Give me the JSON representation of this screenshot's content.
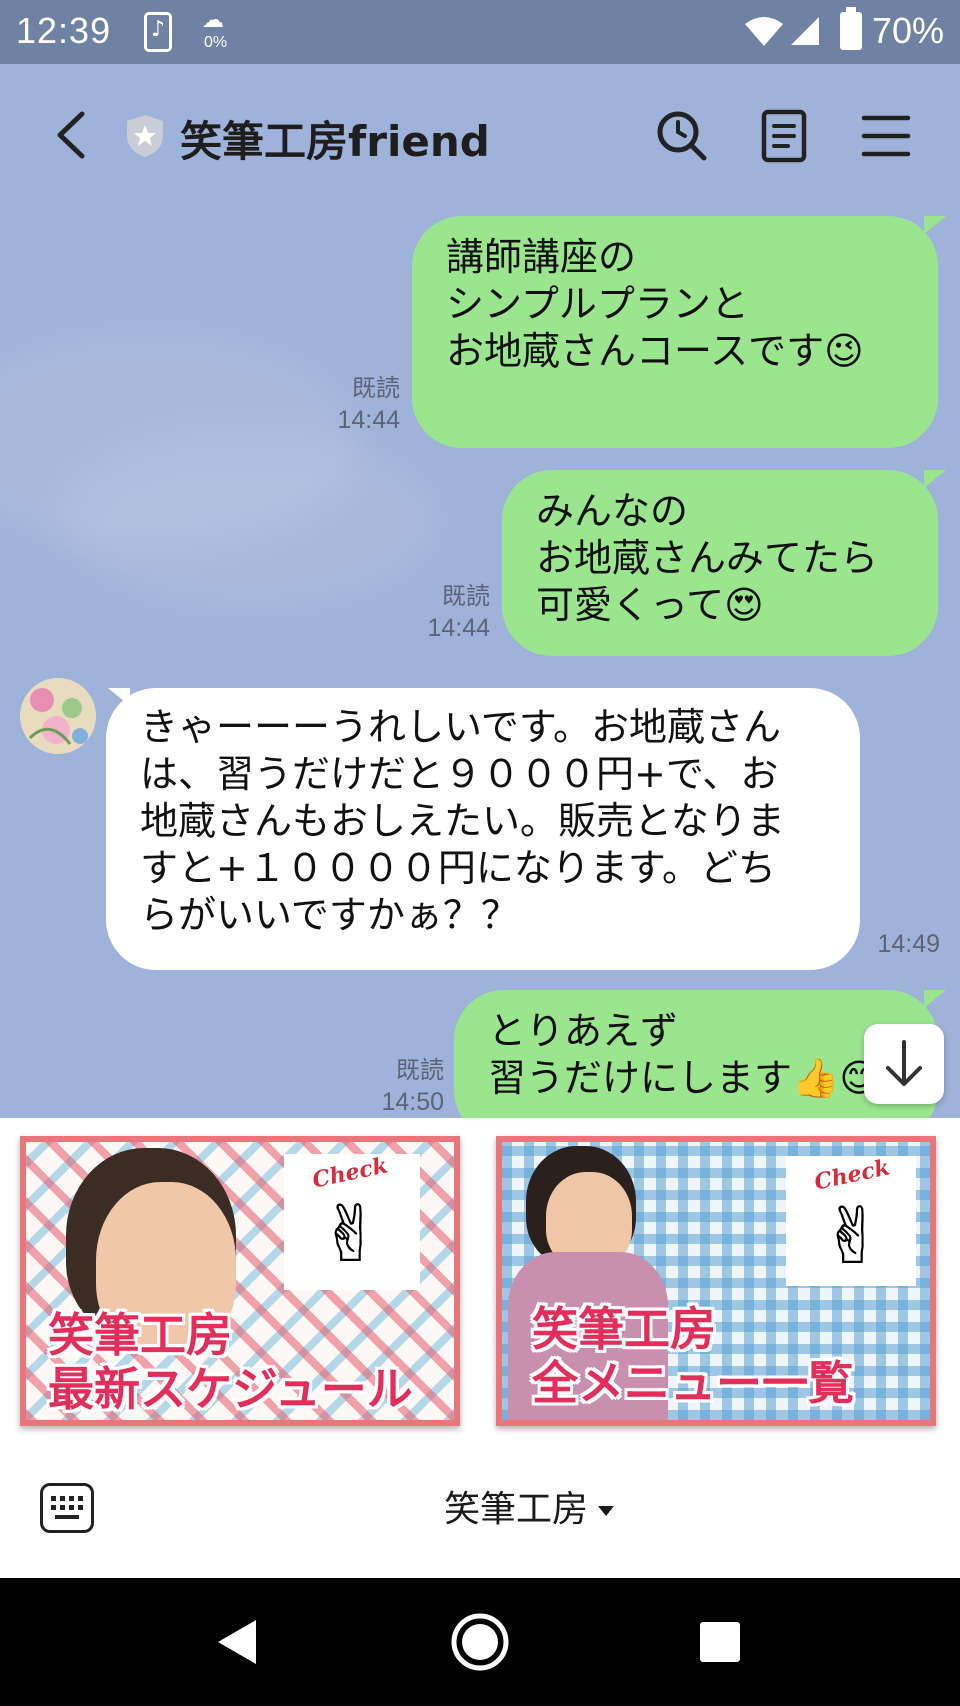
{
  "status_bar": {
    "time": "12:39",
    "weather_percent": "0%",
    "battery": "70%",
    "icons": [
      "music-notification-icon",
      "weather-icon",
      "wifi-icon",
      "signal-icon",
      "battery-icon"
    ]
  },
  "header": {
    "title": "笑筆工房friend",
    "icons": [
      "back-icon",
      "official-account-shield-icon",
      "search-icon",
      "notes-icon",
      "menu-icon"
    ]
  },
  "messages": [
    {
      "direction": "out",
      "lines": [
        "講師講座の",
        "シンプルプランと",
        "お地蔵さんコースです😉"
      ],
      "read": "既読",
      "time": "14:44"
    },
    {
      "direction": "out",
      "lines": [
        "みんなの",
        "お地蔵さんみてたら",
        "可愛くって😍"
      ],
      "read": "既読",
      "time": "14:44"
    },
    {
      "direction": "in",
      "lines": [
        "きゃーーーうれしいです。お地蔵さん",
        "は、習うだけだと９０００円+で、お",
        "地蔵さんもおしえたい。販売となりま",
        "すと+１００００円になります。どち",
        "らがいいですかぁ？？"
      ],
      "time": "14:49"
    },
    {
      "direction": "out",
      "lines": [
        "とりあえず",
        "習うだけにします👍😊"
      ],
      "read": "既読",
      "time": "14:50"
    }
  ],
  "rich_menu": {
    "banners": [
      {
        "check": "Check",
        "lines": [
          "笑筆工房",
          "最新スケジュール"
        ]
      },
      {
        "check": "Check",
        "lines": [
          "笑筆工房",
          "全メニュー一覧"
        ]
      }
    ]
  },
  "bottom_bar": {
    "menu_label": "笑筆工房"
  },
  "colors": {
    "chat_background": "#9fb2d9",
    "outgoing_bubble": "#9be58f",
    "incoming_bubble": "#ffffff",
    "status_bar": "#6f82a3",
    "banner_text": "#e32d5a"
  }
}
